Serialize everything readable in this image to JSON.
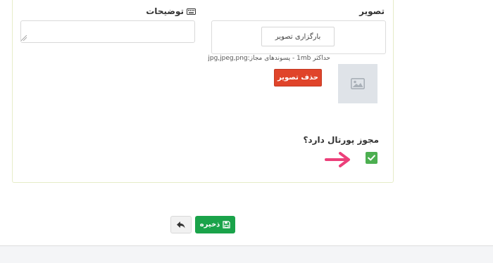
{
  "form": {
    "image_label": "تصویر",
    "description_label": "توضیحات",
    "description_icon": "keyboard-icon",
    "upload_button": "بارگزاری تصویر",
    "upload_hint": "حداکثر 1mb - پسوندهای مجاز:jpg,jpeg,png",
    "delete_button": "حذف تصویر",
    "portal_question": "مجوز پورتال دارد؟",
    "portal_checked": true
  },
  "actions": {
    "save_label": "ذخیره",
    "save_icon": "save-icon",
    "back_icon": "reply-icon"
  },
  "colors": {
    "save": "#1aa34a",
    "delete": "#e0442a",
    "checkbox": "#4caf50",
    "arrow": "#ec407a",
    "card_border": "#e6ecc8"
  }
}
